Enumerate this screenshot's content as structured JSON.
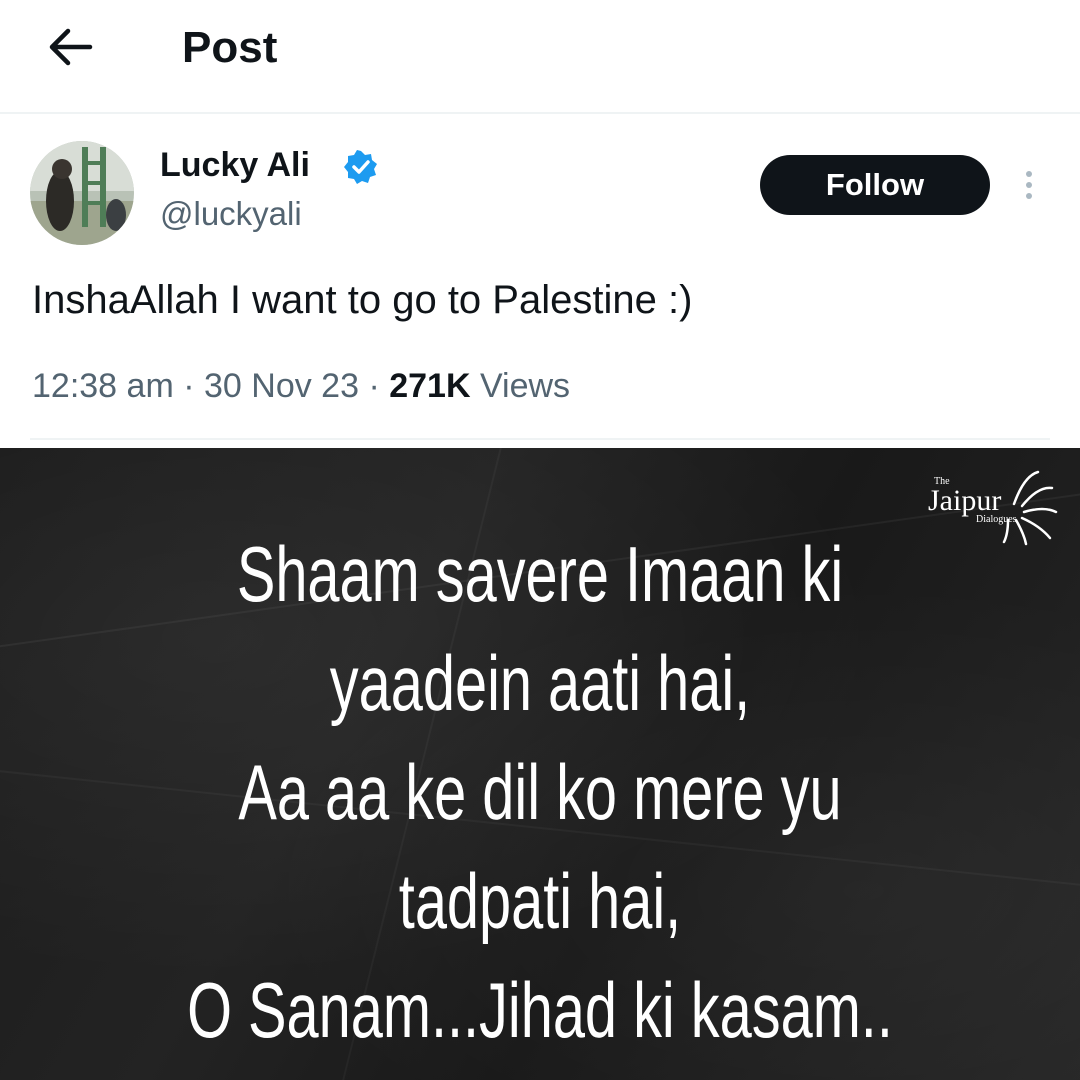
{
  "header": {
    "title": "Post",
    "back_icon": "arrow-left-icon"
  },
  "post": {
    "author_name": "Lucky Ali",
    "handle": "@luckyali",
    "verified_icon": "verified-badge-icon",
    "verified_color": "#1d9bf0",
    "follow_label": "Follow",
    "more_icon": "more-vertical-icon",
    "text": "InshaAllah I want to go to Palestine :)",
    "time": "12:38 am",
    "date": "30 Nov 23",
    "views_count": "271K",
    "views_label": "Views",
    "separator": "·"
  },
  "quote": {
    "lines": [
      "Shaam savere Imaan ki",
      "yaadein aati hai,",
      "Aa aa ke dil ko mere yu",
      "tadpati hai,",
      "O Sanam...Jihad ki kasam.."
    ]
  },
  "logo": {
    "the": "The",
    "main": "Jaipur",
    "sub": "Dialogues"
  }
}
